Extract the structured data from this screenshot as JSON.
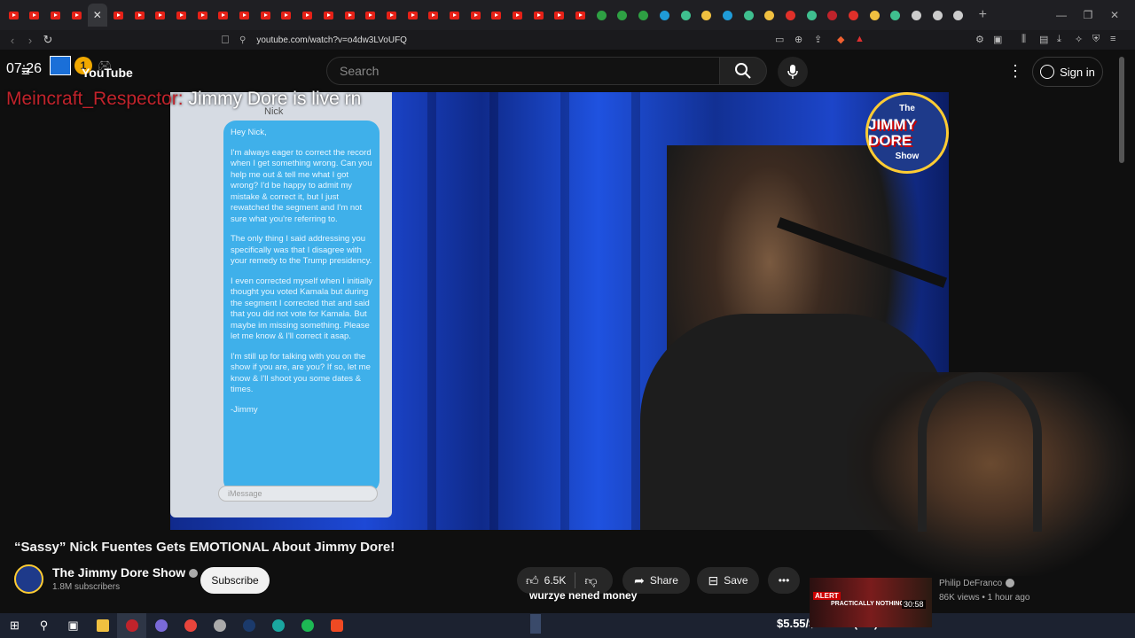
{
  "browser": {
    "tab_count_icons": 29,
    "url": "youtube.com/watch?v=o4dw3LVoUFQ",
    "new_tab_label": "+",
    "window_controls": [
      "—",
      "❐",
      "✕"
    ]
  },
  "overlay": {
    "clock": "07:26",
    "badge_count": "1",
    "chat_user": "Meincraft_Respector:",
    "chat_message": "Jimmy Dore is live rn",
    "caption": "wurzye nened money",
    "goal": "$5.55/$300.00 (2%)"
  },
  "youtube": {
    "logo": "YouTube",
    "search_placeholder": "Search",
    "sign_in": "Sign in"
  },
  "video": {
    "phone_contact": "Nick",
    "messages": [
      "Hey Nick,",
      "I'm always eager to correct the record when I get something wrong. Can you help me out & tell me what I got wrong? I'd be happy to admit my mistake & correct it, but I just rewatched the segment and I'm not sure what you're referring to.",
      "The only thing I said addressing you specifically was that I disagree with your remedy to the Trump presidency.",
      "I even corrected myself when I initially thought you voted Kamala but during the segment I corrected that and said that you did not vote for Kamala. But maybe im missing something. Please let me know & I'll correct it asap.",
      "I'm still up for talking with you on the show if you are, are you? If so, let me know & I'll shoot you some dates & times.",
      "-Jimmy"
    ],
    "message_placeholder": "iMessage",
    "logo_the": "The",
    "logo_name": "JIMMY DORE",
    "logo_show": "Show"
  },
  "meta": {
    "title": "“Sassy” Nick Fuentes Gets EMOTIONAL About Jimmy Dore!",
    "channel": "The Jimmy Dore Show",
    "subscribers": "1.8M subscribers",
    "subscribe": "Subscribe",
    "likes": "6.5K",
    "share": "Share",
    "save": "Save",
    "more": "•••"
  },
  "recommendation": {
    "alert": "ALERT",
    "overlay_text": "PRACTICALLY NOTHING L",
    "duration": "30:58",
    "channel": "Philip DeFranco",
    "meta": "86K views • 1 hour ago"
  },
  "colors": {
    "tab_favicon": "#e62117",
    "chat_user": "#c0232b",
    "background": "#0f0f0f"
  }
}
